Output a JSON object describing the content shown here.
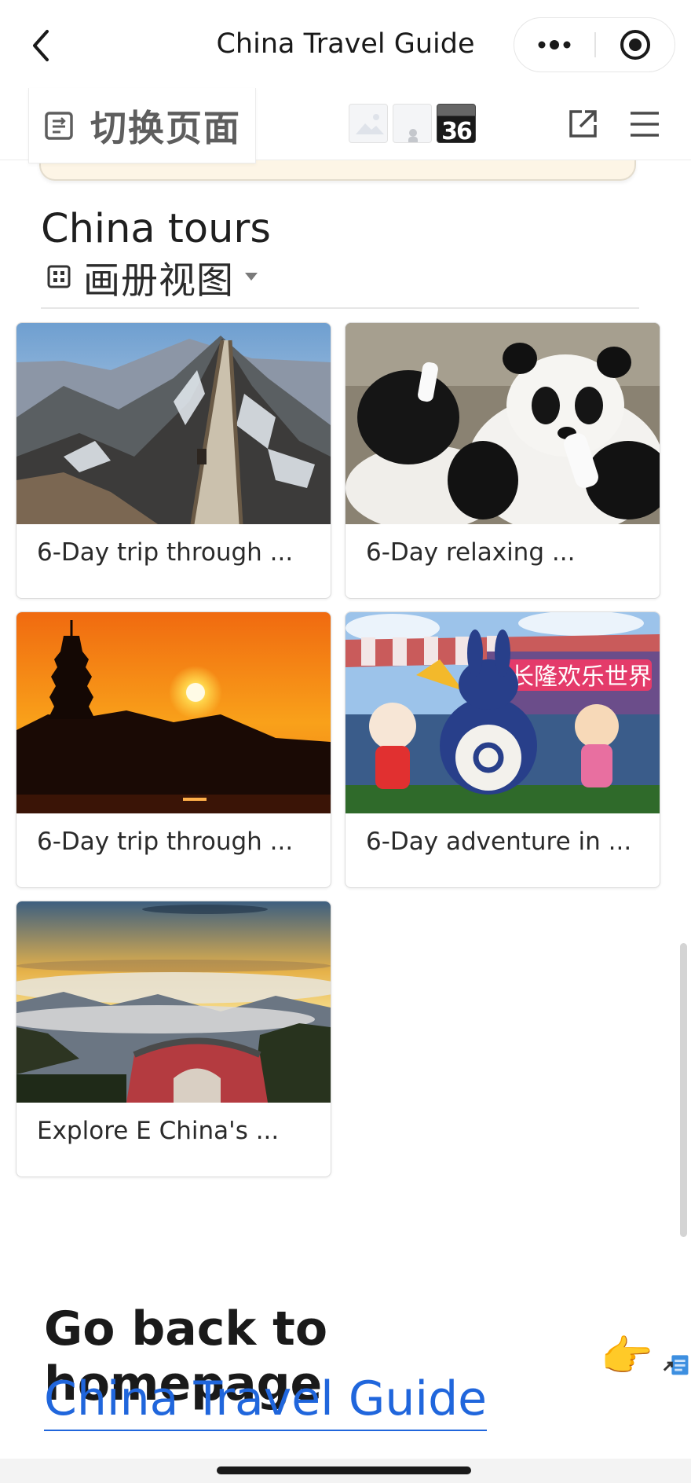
{
  "navbar": {
    "title": "China Travel Guide"
  },
  "toolbar": {
    "switch_page_label": "切换页面",
    "thumbnail_badge": "36"
  },
  "section": {
    "title": "China tours",
    "view_label": "画册视图"
  },
  "gallery": {
    "cards": [
      {
        "caption": "6-Day trip through ...",
        "image": "great-wall-snow-photo"
      },
      {
        "caption": "6-Day relaxing ...",
        "image": "panda-cubs-photo"
      },
      {
        "caption": "6-Day trip through ...",
        "image": "pagoda-sunset-photo"
      },
      {
        "caption": "6-Day adventure in ...",
        "image": "theme-park-mascots-photo"
      },
      {
        "caption": "Explore E China's ...",
        "image": "mountain-sea-of-clouds-photo"
      }
    ]
  },
  "footer": {
    "back_text": "Go back to homepage",
    "emoji": "👉",
    "link_text": "China Travel Guide"
  },
  "theme": {
    "link_color": "#2066dc",
    "callout_bg": "#fdf5e6"
  }
}
